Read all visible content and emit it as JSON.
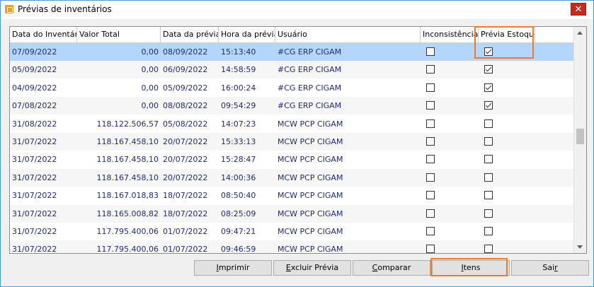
{
  "window": {
    "title": "Prévias de inventários",
    "close_label": "✕"
  },
  "columns": [
    "Data do Inventário",
    "Valor Total",
    "Data da prévia",
    "Hora da prévia",
    "Usuário",
    "Inconsistências",
    "Prévia Estoque"
  ],
  "rows": [
    {
      "data": "07/09/2022",
      "valor": "0,00",
      "previa": "08/09/2022",
      "hora": "15:13:40",
      "usuario": "#CG  ERP CIGAM",
      "inconsistencias": false,
      "estoque": true,
      "selected": true
    },
    {
      "data": "05/09/2022",
      "valor": "0,00",
      "previa": "06/09/2022",
      "hora": "14:58:59",
      "usuario": "#CG  ERP CIGAM",
      "inconsistencias": false,
      "estoque": true
    },
    {
      "data": "04/09/2022",
      "valor": "0,00",
      "previa": "05/09/2022",
      "hora": "16:00:24",
      "usuario": "#CG  ERP CIGAM",
      "inconsistencias": false,
      "estoque": true
    },
    {
      "data": "07/08/2022",
      "valor": "0,00",
      "previa": "08/08/2022",
      "hora": "09:54:29",
      "usuario": "#CG  ERP CIGAM",
      "inconsistencias": false,
      "estoque": true
    },
    {
      "data": "31/08/2022",
      "valor": "118.122.506,57",
      "previa": "05/08/2022",
      "hora": "14:07:23",
      "usuario": "MCW  PCP CIGAM",
      "inconsistencias": false,
      "estoque": false
    },
    {
      "data": "31/07/2022",
      "valor": "118.167.458,10",
      "previa": "20/07/2022",
      "hora": "15:33:13",
      "usuario": "MCW  PCP CIGAM",
      "inconsistencias": false,
      "estoque": false
    },
    {
      "data": "31/07/2022",
      "valor": "118.167.458,10",
      "previa": "20/07/2022",
      "hora": "15:28:47",
      "usuario": "MCW  PCP CIGAM",
      "inconsistencias": false,
      "estoque": false
    },
    {
      "data": "31/07/2022",
      "valor": "118.167.458,10",
      "previa": "20/07/2022",
      "hora": "14:00:36",
      "usuario": "MCW  PCP CIGAM",
      "inconsistencias": false,
      "estoque": false
    },
    {
      "data": "31/07/2022",
      "valor": "118.167.018,83",
      "previa": "18/07/2022",
      "hora": "08:50:40",
      "usuario": "MCW  PCP CIGAM",
      "inconsistencias": false,
      "estoque": false
    },
    {
      "data": "31/07/2022",
      "valor": "118.165.008,82",
      "previa": "18/07/2022",
      "hora": "08:25:09",
      "usuario": "MCW  PCP CIGAM",
      "inconsistencias": false,
      "estoque": false
    },
    {
      "data": "31/07/2022",
      "valor": "117.795.400,06",
      "previa": "01/07/2022",
      "hora": "09:47:21",
      "usuario": "MCW  PCP CIGAM",
      "inconsistencias": false,
      "estoque": false
    },
    {
      "data": "31/07/2022",
      "valor": "117.795.400,06",
      "previa": "01/07/2022",
      "hora": "09:46:59",
      "usuario": "MCW  PCP CIGAM",
      "inconsistencias": false,
      "estoque": false
    }
  ],
  "buttons": [
    {
      "name": "imprimir-button",
      "pre": "",
      "u": "I",
      "post": "mprimir"
    },
    {
      "name": "excluir-previa-button",
      "pre": "",
      "u": "E",
      "post": "xcluir Prévia"
    },
    {
      "name": "comparar-button",
      "pre": "",
      "u": "C",
      "post": "omparar"
    },
    {
      "name": "itens-button",
      "pre": "",
      "u": "I",
      "post": "tens"
    },
    {
      "name": "sair-button",
      "pre": "Sai",
      "u": "r",
      "post": ""
    }
  ],
  "colors": {
    "accent_highlight": "#ef7a2c",
    "selected_row": "#b4d6fa",
    "cell_text": "#1f2a7a",
    "close_button": "#c42b1c"
  },
  "icons": {
    "app": "app-icon",
    "close": "close-icon",
    "scroll_up": "arrow-up-icon",
    "scroll_down": "arrow-down-icon"
  }
}
